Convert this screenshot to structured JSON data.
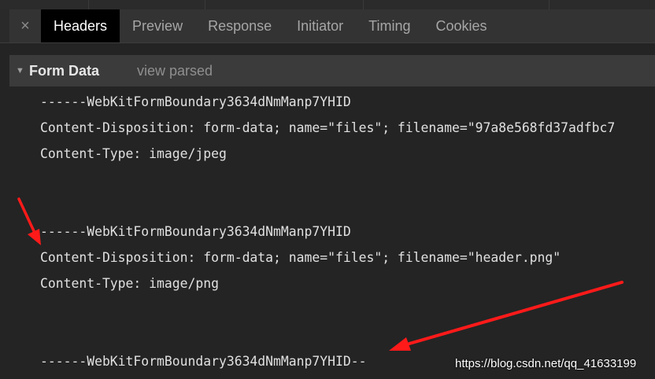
{
  "tabs": {
    "close": "×",
    "items": [
      {
        "label": "Headers",
        "active": true
      },
      {
        "label": "Preview",
        "active": false
      },
      {
        "label": "Response",
        "active": false
      },
      {
        "label": "Initiator",
        "active": false
      },
      {
        "label": "Timing",
        "active": false
      },
      {
        "label": "Cookies",
        "active": false
      }
    ]
  },
  "section": {
    "toggle_icon": "triangle-down-icon",
    "title": "Form Data",
    "view_parsed": "view parsed"
  },
  "payload": {
    "lines": [
      "------WebKitFormBoundary3634dNmManp7YHID",
      "Content-Disposition: form-data; name=\"files\"; filename=\"97a8e568fd37adfbc7",
      "Content-Type: image/jpeg",
      "",
      "",
      "------WebKitFormBoundary3634dNmManp7YHID",
      "Content-Disposition: form-data; name=\"files\"; filename=\"header.png\"",
      "Content-Type: image/png",
      "",
      "",
      "------WebKitFormBoundary3634dNmManp7YHID--"
    ]
  },
  "annotations": {
    "arrow_color": "#ff1a1a"
  },
  "watermark": "https://blog.csdn.net/qq_41633199"
}
